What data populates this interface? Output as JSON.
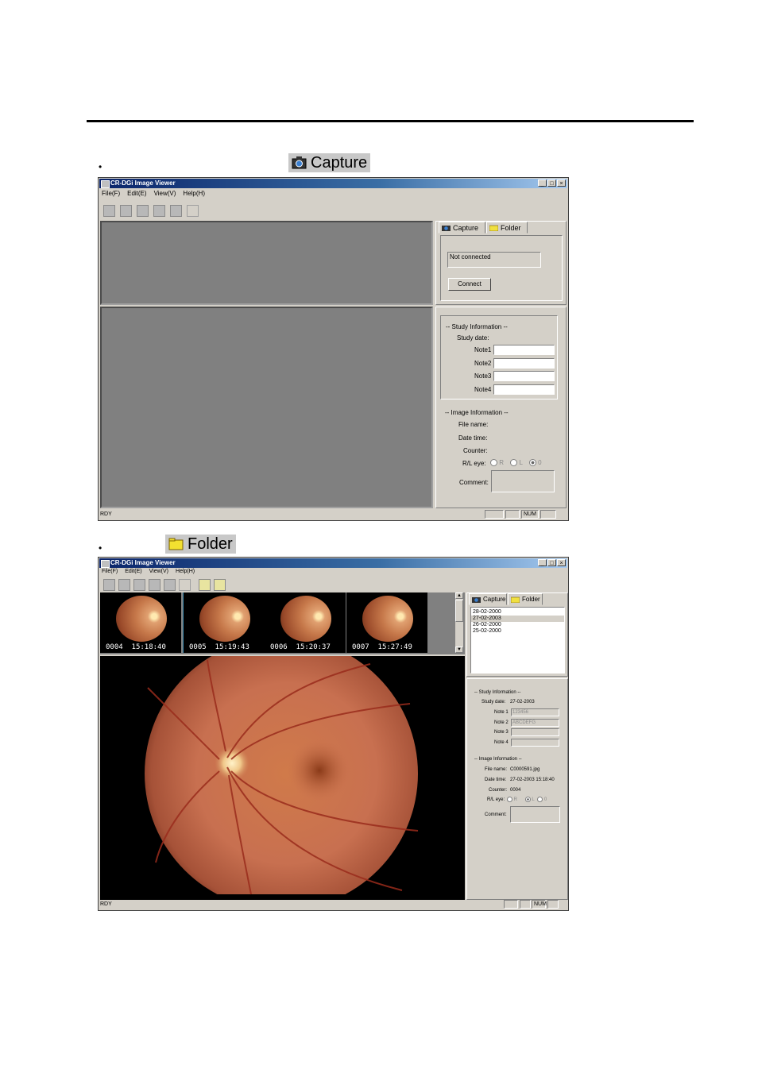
{
  "section1": {
    "bullet": "•",
    "caption": "Capture",
    "icon": "camera-icon"
  },
  "section2": {
    "bullet": "•",
    "caption": "Folder",
    "icon": "folder-icon"
  },
  "app": {
    "title": "CR-DGi Image Viewer",
    "menu": [
      "File(F)",
      "Edit(E)",
      "View(V)",
      "Help(H)"
    ],
    "window_buttons": [
      "_",
      "□",
      "×"
    ]
  },
  "capture_window": {
    "tabs": {
      "capture": "Capture",
      "folder": "Folder"
    },
    "connection_status": "Not connected",
    "connect_button": "Connect",
    "study": {
      "header": "-- Study Information --",
      "date_label": "Study date:",
      "note_labels": [
        "Note1",
        "Note2",
        "Note3",
        "Note4"
      ]
    },
    "image": {
      "header": "-- Image Information --",
      "file_label": "File name:",
      "datetime_label": "Date time:",
      "counter_label": "Counter:",
      "eye_label": "R/L eye:",
      "eye_options": [
        "R",
        "L",
        "0"
      ],
      "comment_label": "Comment:"
    },
    "status": {
      "text": "RDY",
      "num": "NUM"
    }
  },
  "folder_window": {
    "tabs": {
      "capture": "Capture",
      "folder": "Folder"
    },
    "dates": [
      "28-02-2000",
      "27-02-2003",
      "26-02-2000",
      "25-02-2000"
    ],
    "selected_date_index": 1,
    "thumbnails": [
      {
        "id": "0004",
        "time": "15:18:40"
      },
      {
        "id": "0005",
        "time": "15:19:43"
      },
      {
        "id": "0006",
        "time": "15:20:37"
      },
      {
        "id": "0007",
        "time": "15:27:49"
      }
    ],
    "study": {
      "header": "-- Study Information --",
      "date_label": "Study date:",
      "date_value": "27-02-2003",
      "note_labels": [
        "Note 1",
        "Note 2",
        "Note 3",
        "Note 4"
      ],
      "note_values": [
        "123456",
        "ABCDEFG",
        "",
        ""
      ]
    },
    "image": {
      "header": "-- Image Information --",
      "file_label": "File name:",
      "file_value": "C0000591.jpg",
      "datetime_label": "Date time:",
      "datetime_value": "27-02-2003 15:18:40",
      "counter_label": "Counter:",
      "counter_value": "0004",
      "eye_label": "R/L eye:",
      "eye_options": [
        "R",
        "L",
        "0"
      ],
      "comment_label": "Comment:"
    },
    "status": {
      "text": "RDY",
      "num": "NUM"
    }
  }
}
